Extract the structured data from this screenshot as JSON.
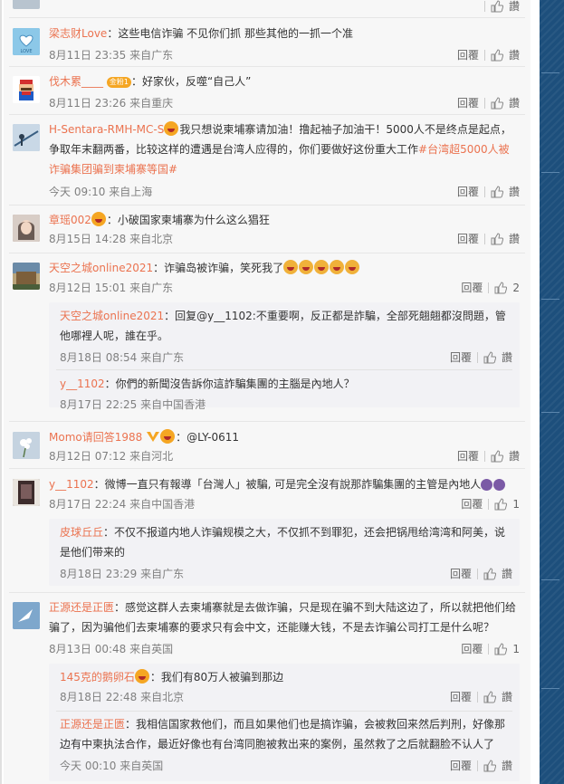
{
  "actions": {
    "reply": "回覆",
    "like": "讚"
  },
  "comments": [
    {
      "id": "c0",
      "name": "",
      "text": "",
      "meta": "",
      "likes": "",
      "partial": true
    },
    {
      "id": "c1",
      "name": "梁志财Love",
      "text": "：这些电信诈骗 不见你们抓 那些其他的一抓一个准",
      "meta": "8月11日 23:35 来自广东",
      "avatar_color": "#5aa9d6"
    },
    {
      "id": "c2",
      "name": "伐木累____",
      "badge": "金粉1",
      "text": "：好家伙，反噬“自己人”",
      "meta": "8月11日 23:26 来自重庆",
      "avatar_color": "#c8312e"
    },
    {
      "id": "c3",
      "name": "H-Sentara-RMH-MC-S",
      "text": "我只想说柬埔寨请加油！撸起袖子加油干！5000人不是终点是起点，争取年末翻两番，比较这样的遭遇是台湾人应得的，你们要做好这份重大工作",
      "topic": "#台湾超5000人被诈骗集团骗到柬埔寨等国#",
      "meta": "今天 09:10 来自上海",
      "avatar_color": "#6d8fb0"
    },
    {
      "id": "c4",
      "name": "章瑶002",
      "text": "：小破国家柬埔寨为什么这么猖狂",
      "meta": "8月15日 14:28 来自北京",
      "avatar_color": "#8a6f62"
    },
    {
      "id": "c5",
      "name": "天空之城online2021",
      "text": "：诈骗岛被诈骗，笑死我了",
      "meta": "8月12日 15:01 来自广东",
      "likes": "2",
      "avatar_color": "#a08b65",
      "replies": [
        {
          "name": "天空之城online2021",
          "text": "：回复@y__1102:不重要啊，反正都是詐騙，全部死翹翹都沒問題，管他哪裡人呢，誰在乎。",
          "meta": "8月18日 08:54 来自广东"
        },
        {
          "name": "y__1102",
          "text": "：你們的新聞沒告訴你這詐騙集團的主腦是內地人？",
          "meta": "8月17日 22:25 来自中国香港"
        }
      ]
    },
    {
      "id": "c6",
      "name": "Momo请回答1988",
      "text": "：@LY-0611",
      "meta": "8月12日 07:12 来自河北",
      "avatar_color": "#9fb3c8"
    },
    {
      "id": "c7",
      "name": "y__1102",
      "text": "：微博一直只有報導「台灣人」被騙, 可是完全沒有說那詐騙集團的主管是內地人",
      "meta": "8月17日 22:24 来自中国香港",
      "likes": "1",
      "avatar_color": "#4a3a3a",
      "replies": [
        {
          "name": "皮球丘丘",
          "text": "：不仅不报道内地人诈骗规模之大，不仅抓不到罪犯，还会把锅甩给湾湾和阿美，说是他们带来的",
          "meta": "8月18日 23:29 来自广东"
        }
      ]
    },
    {
      "id": "c8",
      "name": "正源还是正匮",
      "text": "：感觉这群人去柬埔寨就是去做诈骗，只是现在骗不到大陆这边了，所以就把他们给骗了，因为骗他们去柬埔寨的要求只有会中文，还能赚大钱，不是去诈骗公司打工是什么呢？",
      "meta": "8月13日 00:48 来自英国",
      "likes": "1",
      "avatar_color": "#6a8fb5",
      "replies": [
        {
          "name": "145克的鹅卵石",
          "text": "：我们有80万人被骗到那边",
          "meta": "8月18日 22:48 来自北京"
        },
        {
          "name": "正源还是正匮",
          "text": "：我相信国家救他们，而且如果他们也是搞诈骗，会被救回来然后判刑，好像那边有中柬执法合作，最近好像也有台湾同胞被救出来的案例，虽然救了之后就翻脸不认人了",
          "meta": "今天 00:10 来自英国"
        }
      ]
    }
  ]
}
